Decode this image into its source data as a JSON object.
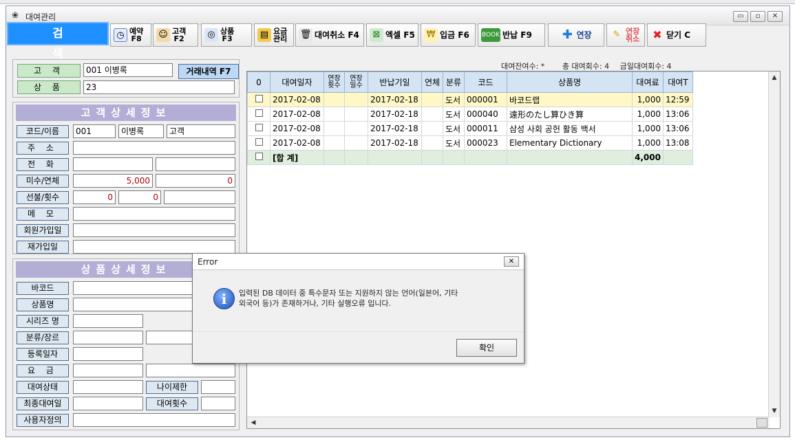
{
  "window": {
    "title": "대여관리",
    "minimize": "▭",
    "maximize": "▫",
    "close": "✕"
  },
  "toolbar": {
    "search": "검 색",
    "reserve": "예약\nF8",
    "customer": "고객\nF2",
    "product": "상품\nF3",
    "fee": "요금\n관리",
    "cancel_rental": "대여취소 F4",
    "excel": "엑셀 F5",
    "deposit": "입금 F6",
    "return": "반납 F9",
    "extend": "연장",
    "extend_cancel": "연장\n취소",
    "close": "닫기 C"
  },
  "search_box": {
    "customer_label": "고 객",
    "customer_value": "001 이병록",
    "product_label": "상 품",
    "product_value": "23",
    "trade_history_button": "거래내역 F7"
  },
  "customer_detail": {
    "header": "고객상세정보",
    "labels": {
      "code_name": "코드/이름",
      "address": "주 소",
      "phone": "전 화",
      "unpaid_overdue": "미수/연체",
      "prepaid_count": "선불/횟수",
      "memo": "메 모",
      "join_date": "회원가입일",
      "rejoin_date": "재가입일"
    },
    "values": {
      "code": "001",
      "name": "이병록",
      "type": "고객",
      "unpaid": "5,000",
      "overdue": "0",
      "prepaid": "0",
      "count": "0"
    }
  },
  "product_detail": {
    "header": "상품상세정보",
    "labels": {
      "barcode": "바코드",
      "product_name": "상품명",
      "series": "시리즈 명",
      "category": "분류/장르",
      "reg_date": "등록일자",
      "fee": "요 금",
      "rental_status": "대여상태",
      "age_limit": "나이제한",
      "last_rental": "최종대여일",
      "rental_count": "대여횟수",
      "user_defined": "사용자정의"
    }
  },
  "stats": {
    "remaining": "대여잔여수: *",
    "total": "총 대여회수: 4",
    "today": "금일대여회수: 4"
  },
  "grid": {
    "corner": "0",
    "headers": [
      "대여일자",
      "연장\n횟수",
      "연장\n일수",
      "반납기일",
      "연체",
      "분류",
      "코드",
      "상품명",
      "대여료",
      "대여T"
    ],
    "rows": [
      {
        "date": "2017-02-08",
        "ext_count": "",
        "ext_days": "",
        "due": "2017-02-18",
        "overdue": "",
        "cat": "도서",
        "code": "000001",
        "name": "바코드랩",
        "fee": "1,000",
        "time": "12:59"
      },
      {
        "date": "2017-02-08",
        "ext_count": "",
        "ext_days": "",
        "due": "2017-02-18",
        "overdue": "",
        "cat": "도서",
        "code": "000040",
        "name": "遠形のたし算ひき算",
        "fee": "1,000",
        "time": "13:06"
      },
      {
        "date": "2017-02-08",
        "ext_count": "",
        "ext_days": "",
        "due": "2017-02-18",
        "overdue": "",
        "cat": "도서",
        "code": "000011",
        "name": "삼성 사회 공헌 활동 백서",
        "fee": "1,000",
        "time": "13:06"
      },
      {
        "date": "2017-02-08",
        "ext_count": "",
        "ext_days": "",
        "due": "2017-02-18",
        "overdue": "",
        "cat": "도서",
        "code": "000023",
        "name": "Elementary Dictionary",
        "fee": "1,000",
        "time": "13:08"
      }
    ],
    "sum_label": "[합 계]",
    "sum_fee": "4,000"
  },
  "dialog": {
    "title": "Error",
    "close": "✕",
    "message_line1": "입력된 DB 데이터 중 특수문자 또는 지원하지 않는 언어(일본어, 기타",
    "message_line2": "외국어 등)가 존재하거나, 기타 실행오류 입니다.",
    "ok": "확인"
  },
  "colors": {
    "search_button": "#1e90ff",
    "section_header": "#b3aed6",
    "selected_row": "#fff8c6",
    "sum_row": "#dfeedd",
    "grid_header": "#d4e4f4"
  }
}
